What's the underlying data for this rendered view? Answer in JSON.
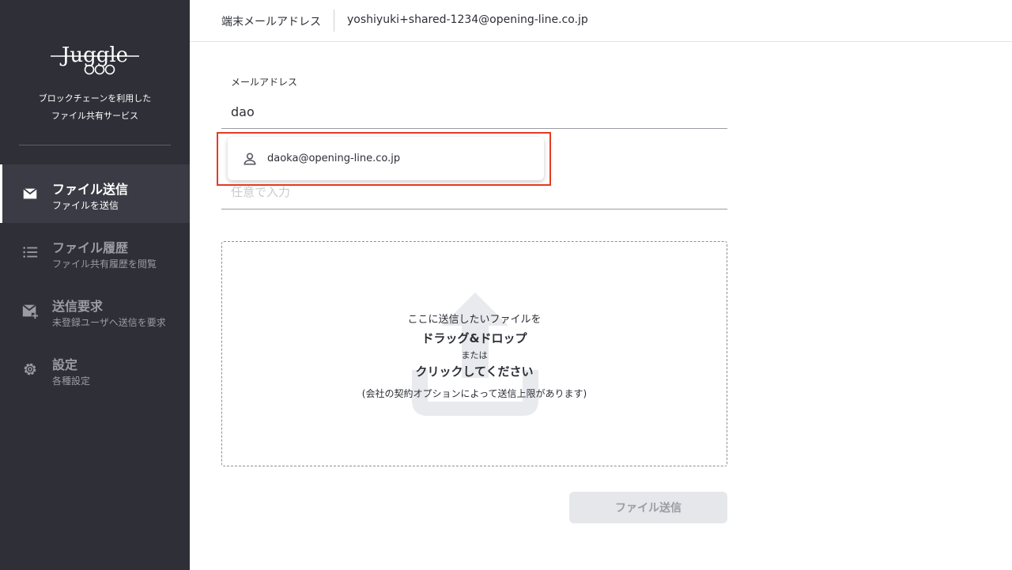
{
  "sidebar": {
    "logo_text": "Juggle",
    "tagline_line1": "ブロックチェーンを利用した",
    "tagline_line2": "ファイル共有サービス",
    "items": [
      {
        "title": "ファイル送信",
        "subtitle": "ファイルを送信",
        "icon": "mail-icon",
        "active": true
      },
      {
        "title": "ファイル履歴",
        "subtitle": "ファイル共有履歴を閲覧",
        "icon": "list-icon",
        "active": false
      },
      {
        "title": "送信要求",
        "subtitle": "未登録ユーザへ送信を要求",
        "icon": "mail-plus-icon",
        "active": false
      },
      {
        "title": "設定",
        "subtitle": "各種設定",
        "icon": "gear-icon",
        "active": false
      }
    ]
  },
  "header": {
    "label": "端末メールアドレス",
    "email": "yoshiyuki+shared-1234@opening-line.co.jp"
  },
  "form": {
    "email_label": "メールアドレス",
    "email_value": "dao",
    "second_placeholder": "任意で入力",
    "suggestion": "daoka@opening-line.co.jp"
  },
  "dropzone": {
    "line1": "ここに送信したいファイルを",
    "line2": "ドラッグ&ドロップ",
    "line3": "または",
    "line4": "クリックしてください",
    "line5": "(会社の契約オプションによって送信上限があります)"
  },
  "submit_label": "ファイル送信",
  "colors": {
    "sidebar_bg": "#2e2f37",
    "highlight": "#e53a22",
    "button_disabled_bg": "#e6e7ea"
  }
}
